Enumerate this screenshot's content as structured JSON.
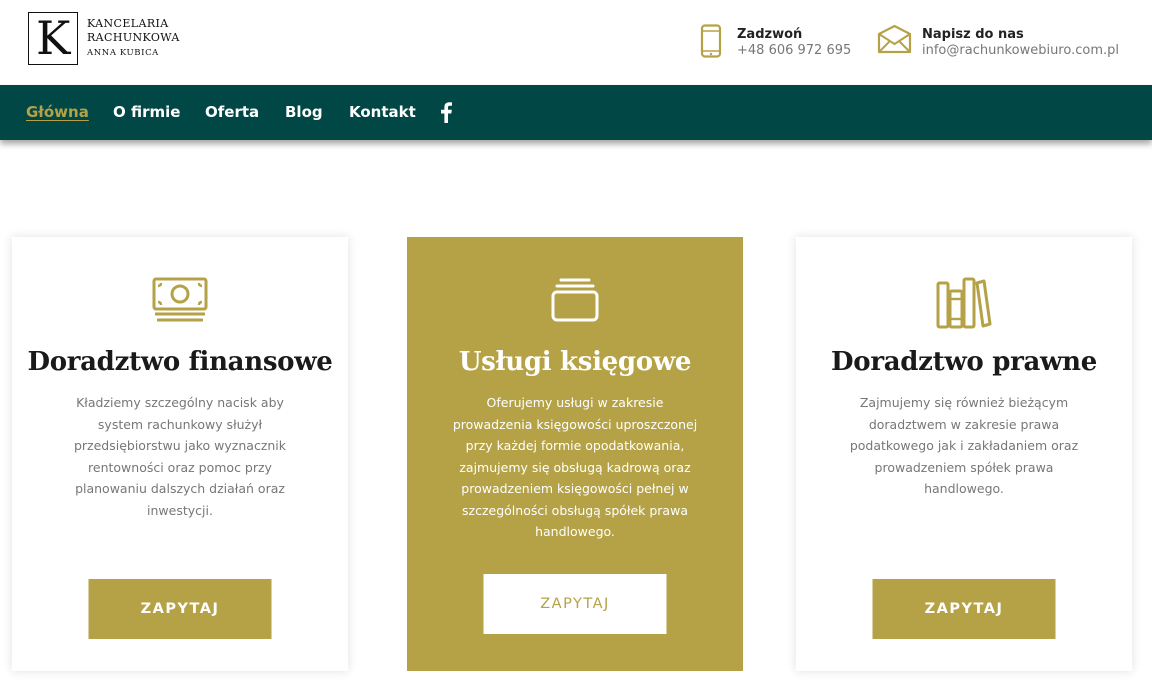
{
  "brand": {
    "logo_letter": "K",
    "line1": "KANCELARIA",
    "line2": "RACHUNKOWA",
    "line3": "ANNA KUBICA"
  },
  "contact": {
    "phone": {
      "title": "Zadzwoń",
      "value": "+48 606 972 695",
      "icon": "phone-icon"
    },
    "mail": {
      "title": "Napisz do nas",
      "value": "info@rachunkowebiuro.com.pl",
      "icon": "envelope-icon"
    }
  },
  "nav": {
    "items": [
      {
        "label": "Główna",
        "active": true
      },
      {
        "label": "O firmie",
        "active": false
      },
      {
        "label": "Oferta",
        "active": false
      },
      {
        "label": "Blog",
        "active": false
      },
      {
        "label": "Kontakt",
        "active": false
      }
    ],
    "social_icon": "facebook-icon"
  },
  "cards": [
    {
      "icon": "banknote-icon",
      "title": "Doradztwo finansowe",
      "text": "Kładziemy szczególny nacisk aby system rachunkowy służył przedsiębiorstwu jako wyznacznik rentowności oraz pomoc przy planowaniu dalszych działań oraz inwestycji.",
      "button": "ZAPYTAJ"
    },
    {
      "icon": "stacked-folders-icon",
      "title": "Usługi księgowe",
      "text": "Oferujemy usługi w zakresie prowadzenia księgowości uproszczonej przy każdej formie opodatkowania, zajmujemy się obsługą kadrową oraz prowadzeniem księgowości pełnej w szczególności obsługą spółek prawa handlowego.",
      "button": "ZAPYTAJ"
    },
    {
      "icon": "books-icon",
      "title": "Doradztwo prawne",
      "text": "Zajmujemy się również bieżącym doradztwem w zakresie prawa podatkowego jak i zakładaniem oraz prowadzeniem spółek prawa handlowego.",
      "button": "ZAPYTAJ"
    }
  ],
  "colors": {
    "accent": "#b5a247",
    "nav_bg": "#004745"
  }
}
